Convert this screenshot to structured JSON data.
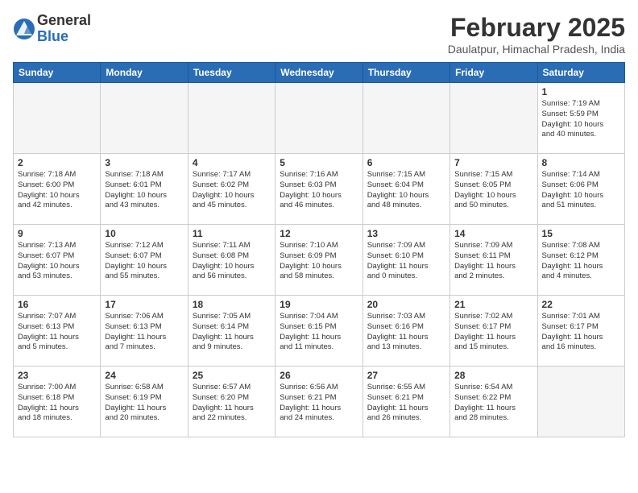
{
  "header": {
    "logo_general": "General",
    "logo_blue": "Blue",
    "month_title": "February 2025",
    "location": "Daulatpur, Himachal Pradesh, India"
  },
  "weekdays": [
    "Sunday",
    "Monday",
    "Tuesday",
    "Wednesday",
    "Thursday",
    "Friday",
    "Saturday"
  ],
  "weeks": [
    [
      {
        "day": "",
        "empty": true
      },
      {
        "day": "",
        "empty": true
      },
      {
        "day": "",
        "empty": true
      },
      {
        "day": "",
        "empty": true
      },
      {
        "day": "",
        "empty": true
      },
      {
        "day": "",
        "empty": true
      },
      {
        "day": "1",
        "info": "Sunrise: 7:19 AM\nSunset: 5:59 PM\nDaylight: 10 hours\nand 40 minutes."
      }
    ],
    [
      {
        "day": "2",
        "info": "Sunrise: 7:18 AM\nSunset: 6:00 PM\nDaylight: 10 hours\nand 42 minutes."
      },
      {
        "day": "3",
        "info": "Sunrise: 7:18 AM\nSunset: 6:01 PM\nDaylight: 10 hours\nand 43 minutes."
      },
      {
        "day": "4",
        "info": "Sunrise: 7:17 AM\nSunset: 6:02 PM\nDaylight: 10 hours\nand 45 minutes."
      },
      {
        "day": "5",
        "info": "Sunrise: 7:16 AM\nSunset: 6:03 PM\nDaylight: 10 hours\nand 46 minutes."
      },
      {
        "day": "6",
        "info": "Sunrise: 7:15 AM\nSunset: 6:04 PM\nDaylight: 10 hours\nand 48 minutes."
      },
      {
        "day": "7",
        "info": "Sunrise: 7:15 AM\nSunset: 6:05 PM\nDaylight: 10 hours\nand 50 minutes."
      },
      {
        "day": "8",
        "info": "Sunrise: 7:14 AM\nSunset: 6:06 PM\nDaylight: 10 hours\nand 51 minutes."
      }
    ],
    [
      {
        "day": "9",
        "info": "Sunrise: 7:13 AM\nSunset: 6:07 PM\nDaylight: 10 hours\nand 53 minutes."
      },
      {
        "day": "10",
        "info": "Sunrise: 7:12 AM\nSunset: 6:07 PM\nDaylight: 10 hours\nand 55 minutes."
      },
      {
        "day": "11",
        "info": "Sunrise: 7:11 AM\nSunset: 6:08 PM\nDaylight: 10 hours\nand 56 minutes."
      },
      {
        "day": "12",
        "info": "Sunrise: 7:10 AM\nSunset: 6:09 PM\nDaylight: 10 hours\nand 58 minutes."
      },
      {
        "day": "13",
        "info": "Sunrise: 7:09 AM\nSunset: 6:10 PM\nDaylight: 11 hours\nand 0 minutes."
      },
      {
        "day": "14",
        "info": "Sunrise: 7:09 AM\nSunset: 6:11 PM\nDaylight: 11 hours\nand 2 minutes."
      },
      {
        "day": "15",
        "info": "Sunrise: 7:08 AM\nSunset: 6:12 PM\nDaylight: 11 hours\nand 4 minutes."
      }
    ],
    [
      {
        "day": "16",
        "info": "Sunrise: 7:07 AM\nSunset: 6:13 PM\nDaylight: 11 hours\nand 5 minutes."
      },
      {
        "day": "17",
        "info": "Sunrise: 7:06 AM\nSunset: 6:13 PM\nDaylight: 11 hours\nand 7 minutes."
      },
      {
        "day": "18",
        "info": "Sunrise: 7:05 AM\nSunset: 6:14 PM\nDaylight: 11 hours\nand 9 minutes."
      },
      {
        "day": "19",
        "info": "Sunrise: 7:04 AM\nSunset: 6:15 PM\nDaylight: 11 hours\nand 11 minutes."
      },
      {
        "day": "20",
        "info": "Sunrise: 7:03 AM\nSunset: 6:16 PM\nDaylight: 11 hours\nand 13 minutes."
      },
      {
        "day": "21",
        "info": "Sunrise: 7:02 AM\nSunset: 6:17 PM\nDaylight: 11 hours\nand 15 minutes."
      },
      {
        "day": "22",
        "info": "Sunrise: 7:01 AM\nSunset: 6:17 PM\nDaylight: 11 hours\nand 16 minutes."
      }
    ],
    [
      {
        "day": "23",
        "info": "Sunrise: 7:00 AM\nSunset: 6:18 PM\nDaylight: 11 hours\nand 18 minutes."
      },
      {
        "day": "24",
        "info": "Sunrise: 6:58 AM\nSunset: 6:19 PM\nDaylight: 11 hours\nand 20 minutes."
      },
      {
        "day": "25",
        "info": "Sunrise: 6:57 AM\nSunset: 6:20 PM\nDaylight: 11 hours\nand 22 minutes."
      },
      {
        "day": "26",
        "info": "Sunrise: 6:56 AM\nSunset: 6:21 PM\nDaylight: 11 hours\nand 24 minutes."
      },
      {
        "day": "27",
        "info": "Sunrise: 6:55 AM\nSunset: 6:21 PM\nDaylight: 11 hours\nand 26 minutes."
      },
      {
        "day": "28",
        "info": "Sunrise: 6:54 AM\nSunset: 6:22 PM\nDaylight: 11 hours\nand 28 minutes."
      },
      {
        "day": "",
        "empty": true
      }
    ]
  ]
}
